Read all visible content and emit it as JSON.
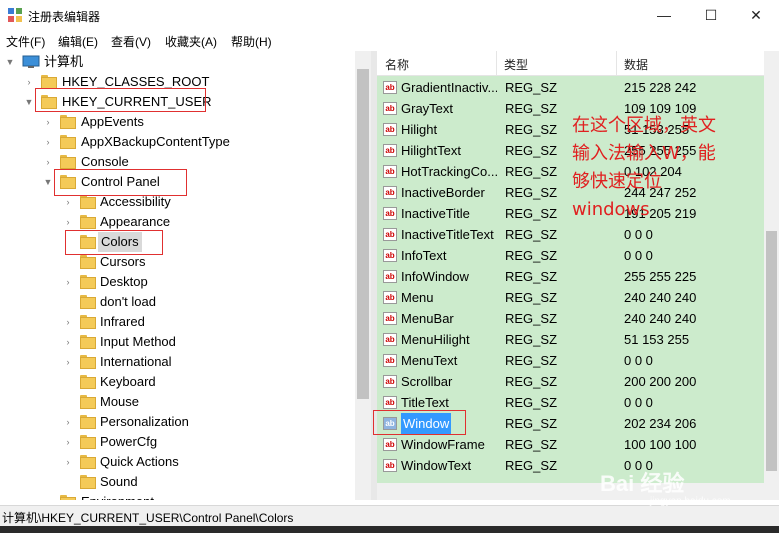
{
  "window": {
    "title": "注册表编辑器",
    "minimize": "—",
    "maximize": "☐",
    "close": "✕"
  },
  "menu": [
    "文件(F)",
    "编辑(E)",
    "查看(V)",
    "收藏夹(A)",
    "帮助(H)"
  ],
  "tree": {
    "root": "计算机",
    "hkcr": "HKEY_CLASSES_ROOT",
    "hkcu": "HKEY_CURRENT_USER",
    "hkcu_children": [
      "AppEvents",
      "AppXBackupContentType",
      "Console",
      "Control Panel"
    ],
    "control_panel_children": [
      "Accessibility",
      "Appearance",
      "Colors",
      "Cursors",
      "Desktop",
      "don't load",
      "Infrared",
      "Input Method",
      "International",
      "Keyboard",
      "Mouse",
      "Personalization",
      "PowerCfg",
      "Quick Actions",
      "Sound"
    ],
    "partial": "Environment"
  },
  "list": {
    "headers": {
      "name": "名称",
      "type": "类型",
      "data": "数据"
    },
    "rows": [
      {
        "name": "GradientInactiv...",
        "type": "REG_SZ",
        "data": "215 228 242"
      },
      {
        "name": "GrayText",
        "type": "REG_SZ",
        "data": "109 109 109"
      },
      {
        "name": "Hilight",
        "type": "REG_SZ",
        "data": "51 153 255"
      },
      {
        "name": "HilightText",
        "type": "REG_SZ",
        "data": "255 255 255"
      },
      {
        "name": "HotTrackingCo...",
        "type": "REG_SZ",
        "data": "0 102 204"
      },
      {
        "name": "InactiveBorder",
        "type": "REG_SZ",
        "data": "244 247 252"
      },
      {
        "name": "InactiveTitle",
        "type": "REG_SZ",
        "data": "191 205 219"
      },
      {
        "name": "InactiveTitleText",
        "type": "REG_SZ",
        "data": "0 0 0"
      },
      {
        "name": "InfoText",
        "type": "REG_SZ",
        "data": "0 0 0"
      },
      {
        "name": "InfoWindow",
        "type": "REG_SZ",
        "data": "255 255 225"
      },
      {
        "name": "Menu",
        "type": "REG_SZ",
        "data": "240 240 240"
      },
      {
        "name": "MenuBar",
        "type": "REG_SZ",
        "data": "240 240 240"
      },
      {
        "name": "MenuHilight",
        "type": "REG_SZ",
        "data": "51 153 255"
      },
      {
        "name": "MenuText",
        "type": "REG_SZ",
        "data": "0 0 0"
      },
      {
        "name": "Scrollbar",
        "type": "REG_SZ",
        "data": "200 200 200"
      },
      {
        "name": "TitleText",
        "type": "REG_SZ",
        "data": "0 0 0"
      },
      {
        "name": "Window",
        "type": "REG_SZ",
        "data": "202 234 206"
      },
      {
        "name": "WindowFrame",
        "type": "REG_SZ",
        "data": "100 100 100"
      },
      {
        "name": "WindowText",
        "type": "REG_SZ",
        "data": "0 0 0"
      }
    ],
    "selected_row": "Window",
    "value_icon": "string-value-icon"
  },
  "status": "计算机\\HKEY_CURRENT_USER\\Control Panel\\Colors",
  "annotation": [
    "在这个区域，英文",
    "输入法输入W，能",
    "够快速定位",
    "windows"
  ],
  "watermark": {
    "main": "Bai 经验",
    "sub": "jingyan.baidu.com"
  },
  "colors": {
    "list_background": "#ccebcc",
    "selection": "#3399ff",
    "annotation": "#e02020"
  }
}
